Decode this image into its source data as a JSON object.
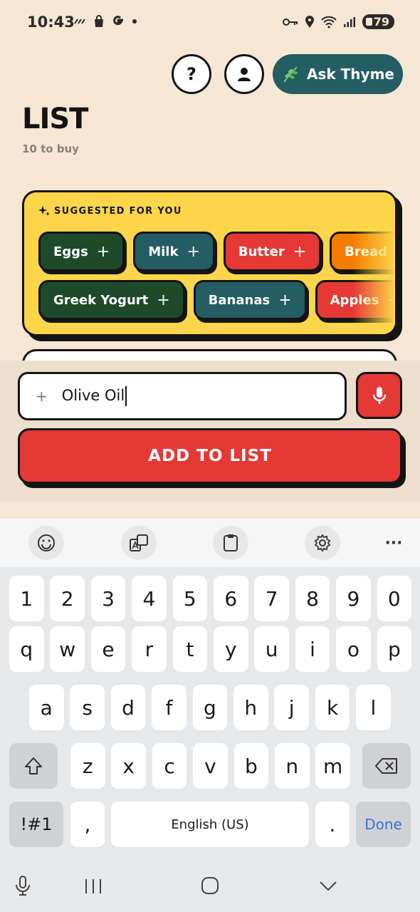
{
  "status_bar": {
    "time": "10:43",
    "left_icons": [
      "missed-call-icon",
      "shopping-bag-icon",
      "google-icon",
      "dot-icon"
    ],
    "right_icons": [
      "key-icon",
      "location-icon",
      "wifi-icon",
      "signal-icon"
    ],
    "battery": "79"
  },
  "header": {
    "help_label": "?",
    "ask_label": "Ask Thyme",
    "title": "LIST",
    "subtitle": "10 to buy"
  },
  "suggestions": {
    "heading": "SUGGESTED FOR YOU",
    "row1": [
      {
        "label": "Eggs",
        "color": "#1e4a2c"
      },
      {
        "label": "Milk",
        "color": "#245d63"
      },
      {
        "label": "Butter",
        "color": "#e53935"
      },
      {
        "label": "Bread",
        "color": "#f57c00"
      }
    ],
    "row2": [
      {
        "label": "Greek Yogurt",
        "color": "#1e4a2c"
      },
      {
        "label": "Bananas",
        "color": "#245d63"
      },
      {
        "label": "Apples",
        "color": "#e53935"
      }
    ],
    "plus": "+"
  },
  "input": {
    "plus": "+",
    "value": "Olive Oil",
    "add_label": "ADD TO LIST"
  },
  "keyboard": {
    "toolbar": [
      "emoji-icon",
      "translate-icon",
      "clipboard-icon",
      "settings-icon",
      "more-icon"
    ],
    "more": "···",
    "numbers": [
      "1",
      "2",
      "3",
      "4",
      "5",
      "6",
      "7",
      "8",
      "9",
      "0"
    ],
    "row1": [
      "q",
      "w",
      "e",
      "r",
      "t",
      "y",
      "u",
      "i",
      "o",
      "p"
    ],
    "row2": [
      "a",
      "s",
      "d",
      "f",
      "g",
      "h",
      "j",
      "k",
      "l"
    ],
    "row3": [
      "z",
      "x",
      "c",
      "v",
      "b",
      "n",
      "m"
    ],
    "symbols": "!#1",
    "comma": ",",
    "space": "English (US)",
    "period": ".",
    "done": "Done"
  },
  "colors": {
    "background": "#f5e7d4",
    "accent_teal": "#245d63",
    "accent_red": "#e53935",
    "card_yellow": "#fdd54a",
    "done_blue": "#3d6fd6"
  }
}
